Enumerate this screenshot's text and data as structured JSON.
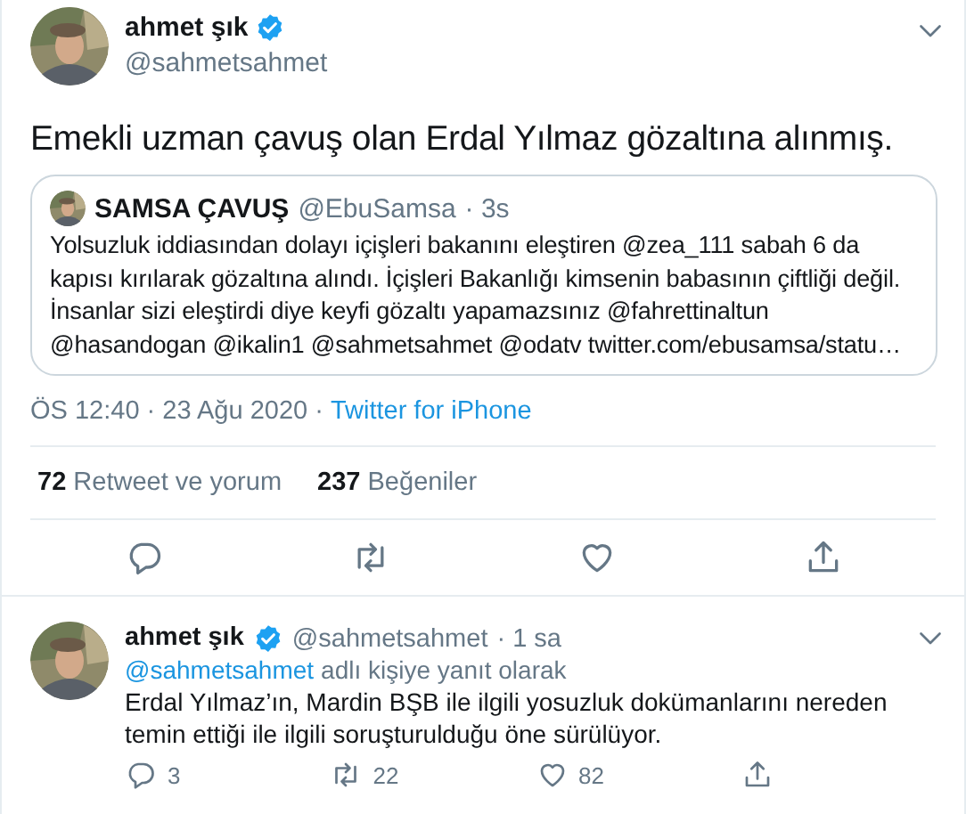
{
  "main_tweet": {
    "author": {
      "name": "ahmet şık",
      "handle": "@sahmetsahmet",
      "verified": true
    },
    "text": "Emekli uzman çavuş olan Erdal Yılmaz gözaltına alınmış.",
    "quoted_tweet": {
      "name": "SAMSA ÇAVUŞ",
      "handle": "@EbuSamsa",
      "time": "· 3s",
      "text": "Yolsuzluk iddiasından dolayı içişleri bakanını eleştiren @zea_111 sabah 6 da kapısı kırılarak gözaltına alındı. İçişleri Bakanlığı kimsenin babasının çiftliği değil. İnsanlar sizi eleştirdi diye keyfi gözaltı yapamazsınız @fahrettinaltun @hasandogan @ikalin1 @sahmetsahmet @odatv twitter.com/ebusamsa/statu…"
    },
    "timestamp": "ÖS 12:40 · 23 Ağu 2020 ·",
    "source": "Twitter for iPhone",
    "stats": [
      {
        "count": "72",
        "label": "Retweet ve yorum"
      },
      {
        "count": "237",
        "label": "Beğeniler"
      }
    ],
    "actions": [
      {
        "kind": "reply"
      },
      {
        "kind": "retweet"
      },
      {
        "kind": "like"
      },
      {
        "kind": "share"
      }
    ]
  },
  "reply_tweet": {
    "author": {
      "name": "ahmet şık",
      "handle": "@sahmetsahmet",
      "verified": true
    },
    "time": "· 1 sa",
    "replying_to": {
      "handle": "@sahmetsahmet",
      "text": "adlı kişiye yanıt olarak"
    },
    "text": "Erdal Yılmaz’ın, Mardin BŞB ile ilgili yosuzluk dokümanlarını nereden temin ettiği ile ilgili soruşturulduğu öne sürülüyor.",
    "actions": [
      {
        "kind": "reply",
        "count": "3"
      },
      {
        "kind": "retweet",
        "count": "22"
      },
      {
        "kind": "like",
        "count": "82"
      },
      {
        "kind": "share"
      }
    ]
  }
}
